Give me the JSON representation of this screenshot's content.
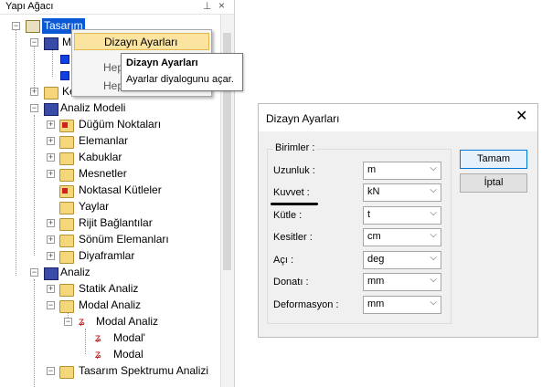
{
  "panel": {
    "title": "Yapı Ağacı",
    "pin": "ᵖ",
    "close": "×"
  },
  "tree": {
    "tasarim": "Tasarım",
    "m": "M",
    "ke": "Ke",
    "analiz_modeli": "Analiz Modeli",
    "dugum": "Düğüm Noktaları",
    "elemanlar": "Elemanlar",
    "kabuklar": "Kabuklar",
    "mesnetler": "Mesnetler",
    "noktasal": "Noktasal Kütleler",
    "yaylar": "Yaylar",
    "rijit": "Rijit Bağlantılar",
    "sonum": "Sönüm Elemanları",
    "diyaframlar": "Diyaframlar",
    "analiz": "Analiz",
    "statik": "Statik Analiz",
    "modal_analiz": "Modal Analiz",
    "modal_analiz_sub": "Modal Analiz",
    "modal_prime": "Modal'",
    "modal": "Modal",
    "tasarim_spektrumu": "Tasarım Spektrumu Analizi",
    "bottom_partial": "Tasarım Spekt..."
  },
  "context_menu": {
    "item1": "Dizayn Ayarları",
    "item2": "Hep",
    "item3": "Hep"
  },
  "tooltip": {
    "title": "Dizayn Ayarları",
    "text": "Ayarlar diyalogunu açar."
  },
  "dialog": {
    "title": "Dizayn Ayarları",
    "group": "Birimler :",
    "rows": [
      {
        "label": "Uzunluk :",
        "value": "m"
      },
      {
        "label": "Kuvvet :",
        "value": "kN"
      },
      {
        "label": "Kütle :",
        "value": "t"
      },
      {
        "label": "Kesitler :",
        "value": "cm"
      },
      {
        "label": "Açı :",
        "value": "deg"
      },
      {
        "label": "Donatı :",
        "value": "mm"
      },
      {
        "label": "Deformasyon :",
        "value": "mm"
      }
    ],
    "ok": "Tamam",
    "cancel": "İptal"
  }
}
